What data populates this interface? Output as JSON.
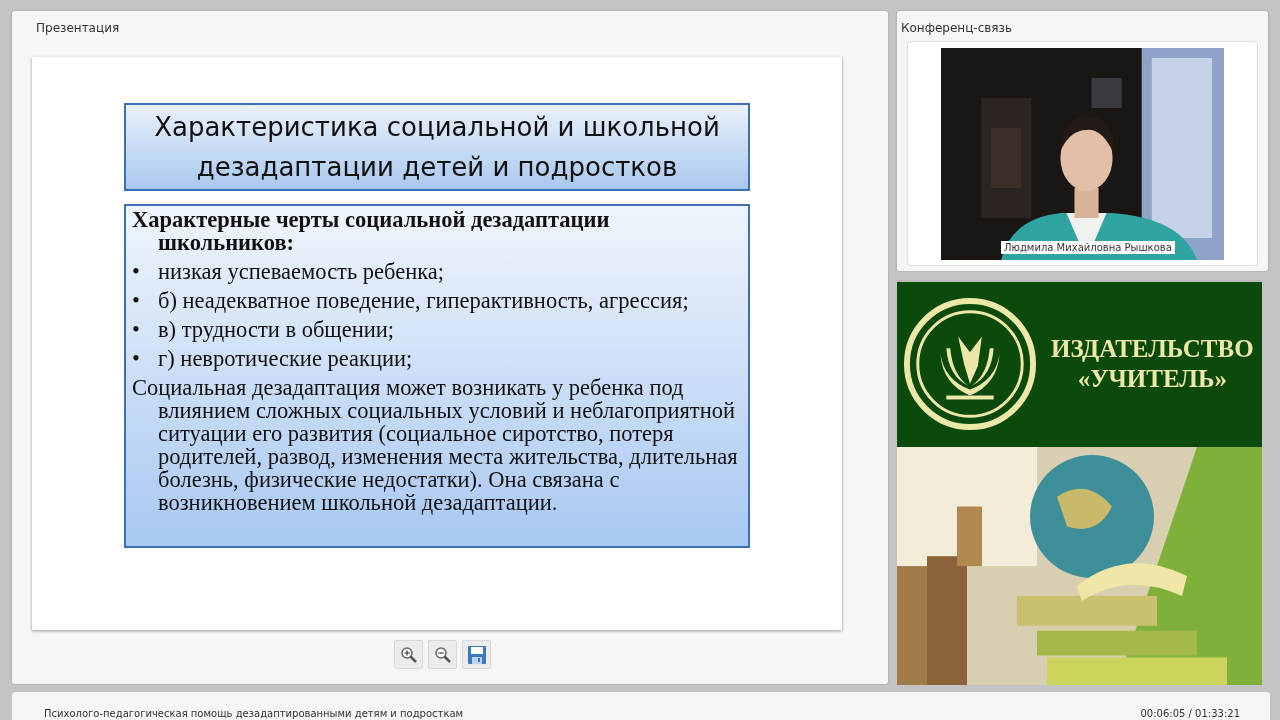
{
  "presentation_panel": {
    "title": "Презентация",
    "slide": {
      "title": "Характеристика социальной и школьной дезадаптации детей и подростков",
      "heading": "Характерные черты социальной дезадаптации школьников:",
      "bullets": [
        {
          "marker": "•",
          "text": "низкая успеваемость ребенка;"
        },
        {
          "marker": "•",
          "text": "б) неадекватное поведение, гиперактивность, агрессия;"
        },
        {
          "marker": "•",
          "text": "в) трудности в общении;"
        },
        {
          "marker": "•",
          "text": "г) невротические реакции;"
        }
      ],
      "paragraph": "Социальная дезадаптация может возникать у ребенка  под влиянием сложных социальных условий и неблагоприятной ситуации его развития (социальное сиротство, потеря родителей, развод, изменения места жительства, длительная болезнь, физические недостатки). Она связана с возникновением школьной дезадаптации."
    },
    "toolbar": [
      {
        "kind": "zoom_in"
      },
      {
        "kind": "zoom_out"
      },
      {
        "kind": "save"
      }
    ]
  },
  "conference_panel": {
    "title": "Конференц-связь",
    "video": {
      "kind": "picture",
      "speaker_name": "Людмила Михайловна Рышкова"
    }
  },
  "publisher_banner": {
    "name_line1": "ИЗДАТЕЛЬСТВО",
    "name_line2": "«УЧИТЕЛЬ»"
  },
  "status_bar": {
    "course_title": "Психолого-педагогическая помощь дезадаптированными детям и подросткам",
    "time": "00:06:05 / 01:33:21"
  }
}
